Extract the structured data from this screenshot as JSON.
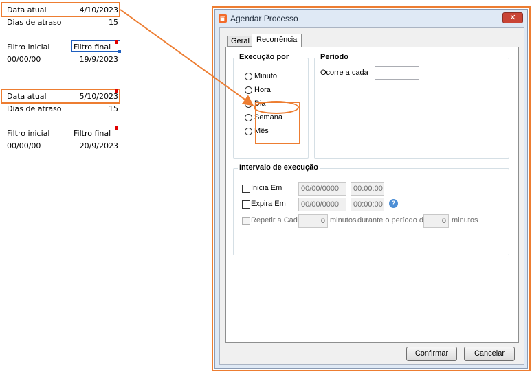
{
  "sheet": {
    "block1": {
      "data_atual_label": "Data atual",
      "data_atual_value": "4/10/2023",
      "dias_label": "Dias de atraso",
      "dias_value": "15",
      "filtro_inicial_label": "Filtro inicial",
      "filtro_final_label": "Filtro final",
      "filtro_inicial_value": "00/00/00",
      "filtro_final_value": "19/9/2023"
    },
    "block2": {
      "data_atual_label": "Data atual",
      "data_atual_value": "5/10/2023",
      "dias_label": "Dias de atraso",
      "dias_value": "15",
      "filtro_inicial_label": "Filtro inicial",
      "filtro_final_label": "Filtro final",
      "filtro_inicial_value": "00/00/00",
      "filtro_final_value": "20/9/2023"
    }
  },
  "dialog": {
    "title": "Agendar Processo",
    "close_label": "✕",
    "tabs": [
      "Geral",
      "Recorrência"
    ],
    "active_tab": "Recorrência",
    "execucao": {
      "title": "Execução por",
      "options": [
        "Minuto",
        "Hora",
        "Dia",
        "Semana",
        "Mês"
      ]
    },
    "periodo": {
      "title": "Período",
      "ocorre_label": "Ocorre a cada",
      "ocorre_value": ""
    },
    "intervalo": {
      "title": "Intervalo de execução",
      "inicia_label": "Inicia Em",
      "inicia_date": "00/00/0000",
      "inicia_time": "00:00:00",
      "expira_label": "Expira Em",
      "expira_date": "00/00/0000",
      "expira_time": "00:00:00",
      "repetir_label": "Repetir a Cada",
      "repetir_value": "0",
      "minutos_label": "minutos",
      "durante_label": "durante o período de",
      "periodo_value": "0",
      "minutos2_label": "minutos"
    },
    "buttons": {
      "confirmar": "Confirmar",
      "cancelar": "Cancelar"
    }
  },
  "colors": {
    "highlight": "#ed7d31",
    "selection": "#1f5fbf",
    "comment": "#e00000"
  }
}
